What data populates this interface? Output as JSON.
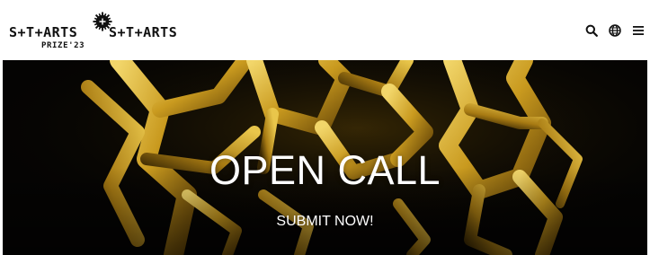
{
  "header": {
    "prize_logo": {
      "brand": "S+T+ARTS",
      "subtitle": "PRIZE'23"
    },
    "site_logo": "S+T+ARTS",
    "icons": [
      "search-icon",
      "globe-icon",
      "menu-icon"
    ]
  },
  "hero": {
    "title": "OPEN CALL",
    "cta": "SUBMIT NOW!"
  },
  "colors": {
    "header_bg": "#ffffff",
    "hero_bg": "#050403",
    "gold": "#d8b336",
    "text_light": "#ffffff",
    "text_dark": "#111111"
  }
}
